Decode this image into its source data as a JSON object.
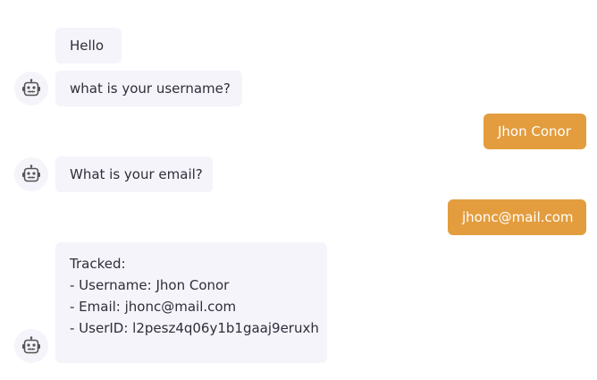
{
  "chat": {
    "messages": [
      {
        "sender": "bot",
        "text": "Hello"
      },
      {
        "sender": "bot",
        "text": "what is your username?"
      },
      {
        "sender": "user",
        "text": "Jhon Conor"
      },
      {
        "sender": "bot",
        "text": "What is your email?"
      },
      {
        "sender": "user",
        "text": "jhonc@mail.com"
      },
      {
        "sender": "bot",
        "text": "Tracked:\n- Username: Jhon Conor\n- Email: jhonc@mail.com\n- UserID: l2pesz4q06y1b1gaaj9eruxh"
      }
    ],
    "bot_avatar_icon": "robot-icon",
    "colors": {
      "bot_bubble": "#f5f4fb",
      "user_bubble": "#e39d3e",
      "user_text": "#ffffff",
      "bot_text": "#2e2e3a"
    }
  }
}
